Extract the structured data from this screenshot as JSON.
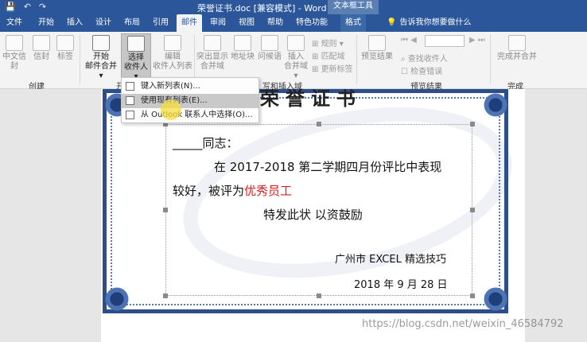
{
  "titlebar": {
    "doc_title": "荣誉证书.doc [兼容模式] - Word",
    "context_tab_title": "文本框工具",
    "quick_access": [
      "💾",
      "↶",
      "↷"
    ]
  },
  "tabs": [
    {
      "label": "文件"
    },
    {
      "label": "开始"
    },
    {
      "label": "插入"
    },
    {
      "label": "设计"
    },
    {
      "label": "布局"
    },
    {
      "label": "引用"
    },
    {
      "label": "邮件"
    },
    {
      "label": "审阅"
    },
    {
      "label": "视图"
    },
    {
      "label": "帮助"
    },
    {
      "label": "特色功能"
    },
    {
      "label": "格式"
    }
  ],
  "tell_me": "告诉我你想要做什么",
  "ribbon": {
    "create": {
      "chinese_envelope": "中文信封",
      "envelope": "信封",
      "label": "标签",
      "group_label": "创建"
    },
    "start_merge": {
      "start_merge_line1": "开始",
      "start_merge_line2": "邮件合并 ▾",
      "select_recipients_line1": "选择",
      "select_recipients_line2": "收件人 ▾",
      "edit_recipients_line1": "编辑",
      "edit_recipients_line2": "收件人列表",
      "group_label": "开"
    },
    "write_insert": {
      "highlight_fields_line1": "突出显示",
      "highlight_fields_line2": "合并域",
      "address_block": "地址块",
      "greeting_line": "问候语",
      "insert_field_line1": "插入",
      "insert_field_line2": "合并域 ▾",
      "rules": "规则 ▾",
      "match_fields": "匹配域",
      "update_labels": "更新标签",
      "group_label": "写和插入域"
    },
    "preview": {
      "preview_results": "预览结果",
      "find_recipient": "查找收件人",
      "check_errors": "检查错误",
      "group_label": "预览结果"
    },
    "finish": {
      "finish_merge": "完成并合并",
      "group_label": "完成"
    }
  },
  "menu": {
    "items": [
      {
        "label": "键入新列表(N)..."
      },
      {
        "label": "使用现有列表(E)..."
      },
      {
        "label": "从 Outlook 联系人中选择(O)..."
      }
    ]
  },
  "document": {
    "title": "荣誉证书",
    "line1": "_____同志：",
    "line2": "在 2017-2018 第二学期四月份评比中表现",
    "line3a": "较好，被评为",
    "line3b": "优秀员工",
    "line4": "特发此状 以资鼓励",
    "signature": "广州市 EXCEL 精选技巧",
    "date": "2018 年 9 月 28 日"
  },
  "watermark": "https://blog.csdn.net/weixin_46584792"
}
